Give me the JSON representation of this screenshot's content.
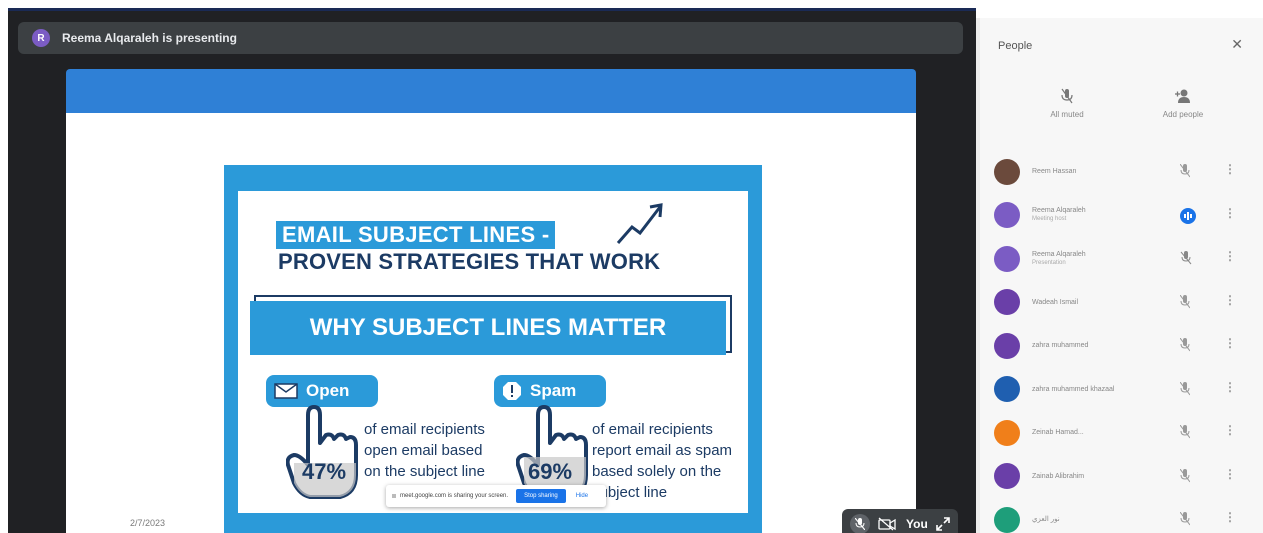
{
  "presentation_bar": {
    "avatar_initial": "R",
    "text": "Reema Alqaraleh is presenting",
    "avatar_color": "#7b5cc4"
  },
  "slide": {
    "date": "2/7/2023",
    "title_line1": "EMAIL SUBJECT LINES -",
    "title_line2": "PROVEN STRATEGIES THAT WORK",
    "banner": "WHY SUBJECT LINES MATTER",
    "stats": [
      {
        "label": "Open",
        "percent": "47%",
        "description": "of email recipients open email based on the subject line",
        "icon": "envelope-icon"
      },
      {
        "label": "Spam",
        "percent": "69%",
        "description": "of email recipients report email as spam based solely on the subject line",
        "icon": "warning-icon"
      }
    ],
    "accent_color": "#2b9ad9",
    "navy_color": "#1c3b64"
  },
  "share_notice": {
    "text": "meet.google.com is sharing your screen.",
    "stop_button": "Stop sharing",
    "hide_link": "Hide"
  },
  "self_tile": {
    "name": "You"
  },
  "people_panel": {
    "title": "People",
    "actions": [
      {
        "label": "All muted",
        "icon": "mic-off-icon"
      },
      {
        "label": "Add people",
        "icon": "add-person-icon"
      }
    ],
    "participants": [
      {
        "name": "Reem Hassan",
        "sub": "",
        "color": "#6b4a3c",
        "mic": "mic-off"
      },
      {
        "name": "Reema Alqaraleh",
        "sub": "Meeting host",
        "color": "#7b5cc4",
        "mic": "speaking"
      },
      {
        "name": "Reema Alqaraleh",
        "sub": "Presentation",
        "color": "#7b5cc4",
        "mic": "presenting"
      },
      {
        "name": "Wadeah Ismail",
        "sub": "",
        "color": "#6a3fa8",
        "mic": "mic-off"
      },
      {
        "name": "zahra muhammed",
        "sub": "",
        "color": "#6a3fa8",
        "mic": "mic-off"
      },
      {
        "name": "zahra muhammed khazaal",
        "sub": "",
        "color": "#1f5fb0",
        "mic": "mic-off"
      },
      {
        "name": "Zeinab Hamad...",
        "sub": "",
        "color": "#f07f1a",
        "mic": "mic-off"
      },
      {
        "name": "Zainab Alibrahim",
        "sub": "",
        "color": "#6a3fa8",
        "mic": "mic-off"
      },
      {
        "name": "نور العزي",
        "sub": "",
        "color": "#1e9e7a",
        "mic": "mic-off"
      }
    ]
  }
}
